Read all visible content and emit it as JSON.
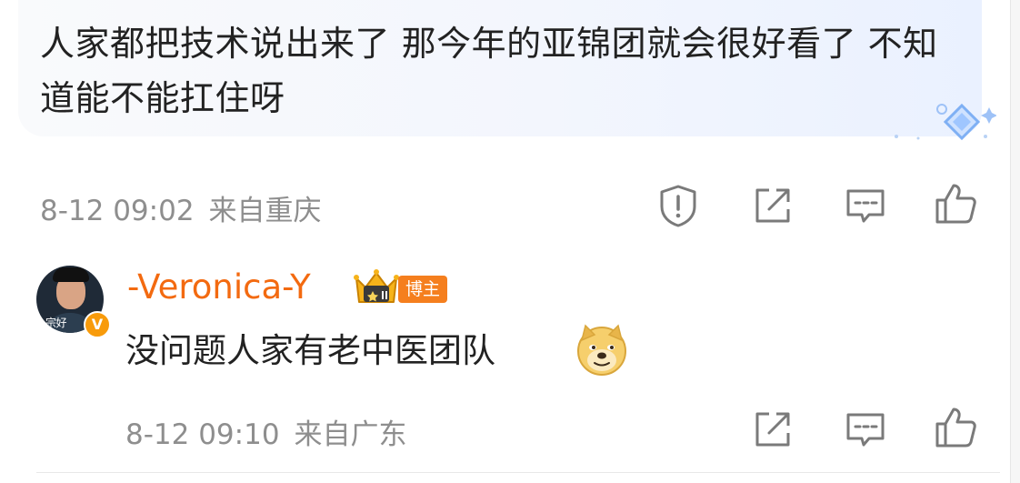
{
  "comment": {
    "text": "人家都把技术说出来了 那今年的亚锦团就会很好看了 不知道能不能扛住呀",
    "time": "8-12 09:02",
    "location": "来自重庆"
  },
  "reply": {
    "username": "-Veronica-Y",
    "author_badge": "博主",
    "avatar_caption": "宗好",
    "verified_mark": "V",
    "text": "没问题人家有老中医团队",
    "time": "8-12 09:10",
    "location": "来自广东"
  },
  "icons": {
    "report": "report-exclamation-icon",
    "share": "share-edit-icon",
    "comment": "comment-bubble-icon",
    "like": "thumbs-up-icon",
    "crown": "crown-badge-icon",
    "emoji": "doge-emoji"
  },
  "colors": {
    "username": "#f36a10",
    "badge": "#f57f1e",
    "meta_text": "#8e8e8e",
    "body_text": "#222222"
  }
}
